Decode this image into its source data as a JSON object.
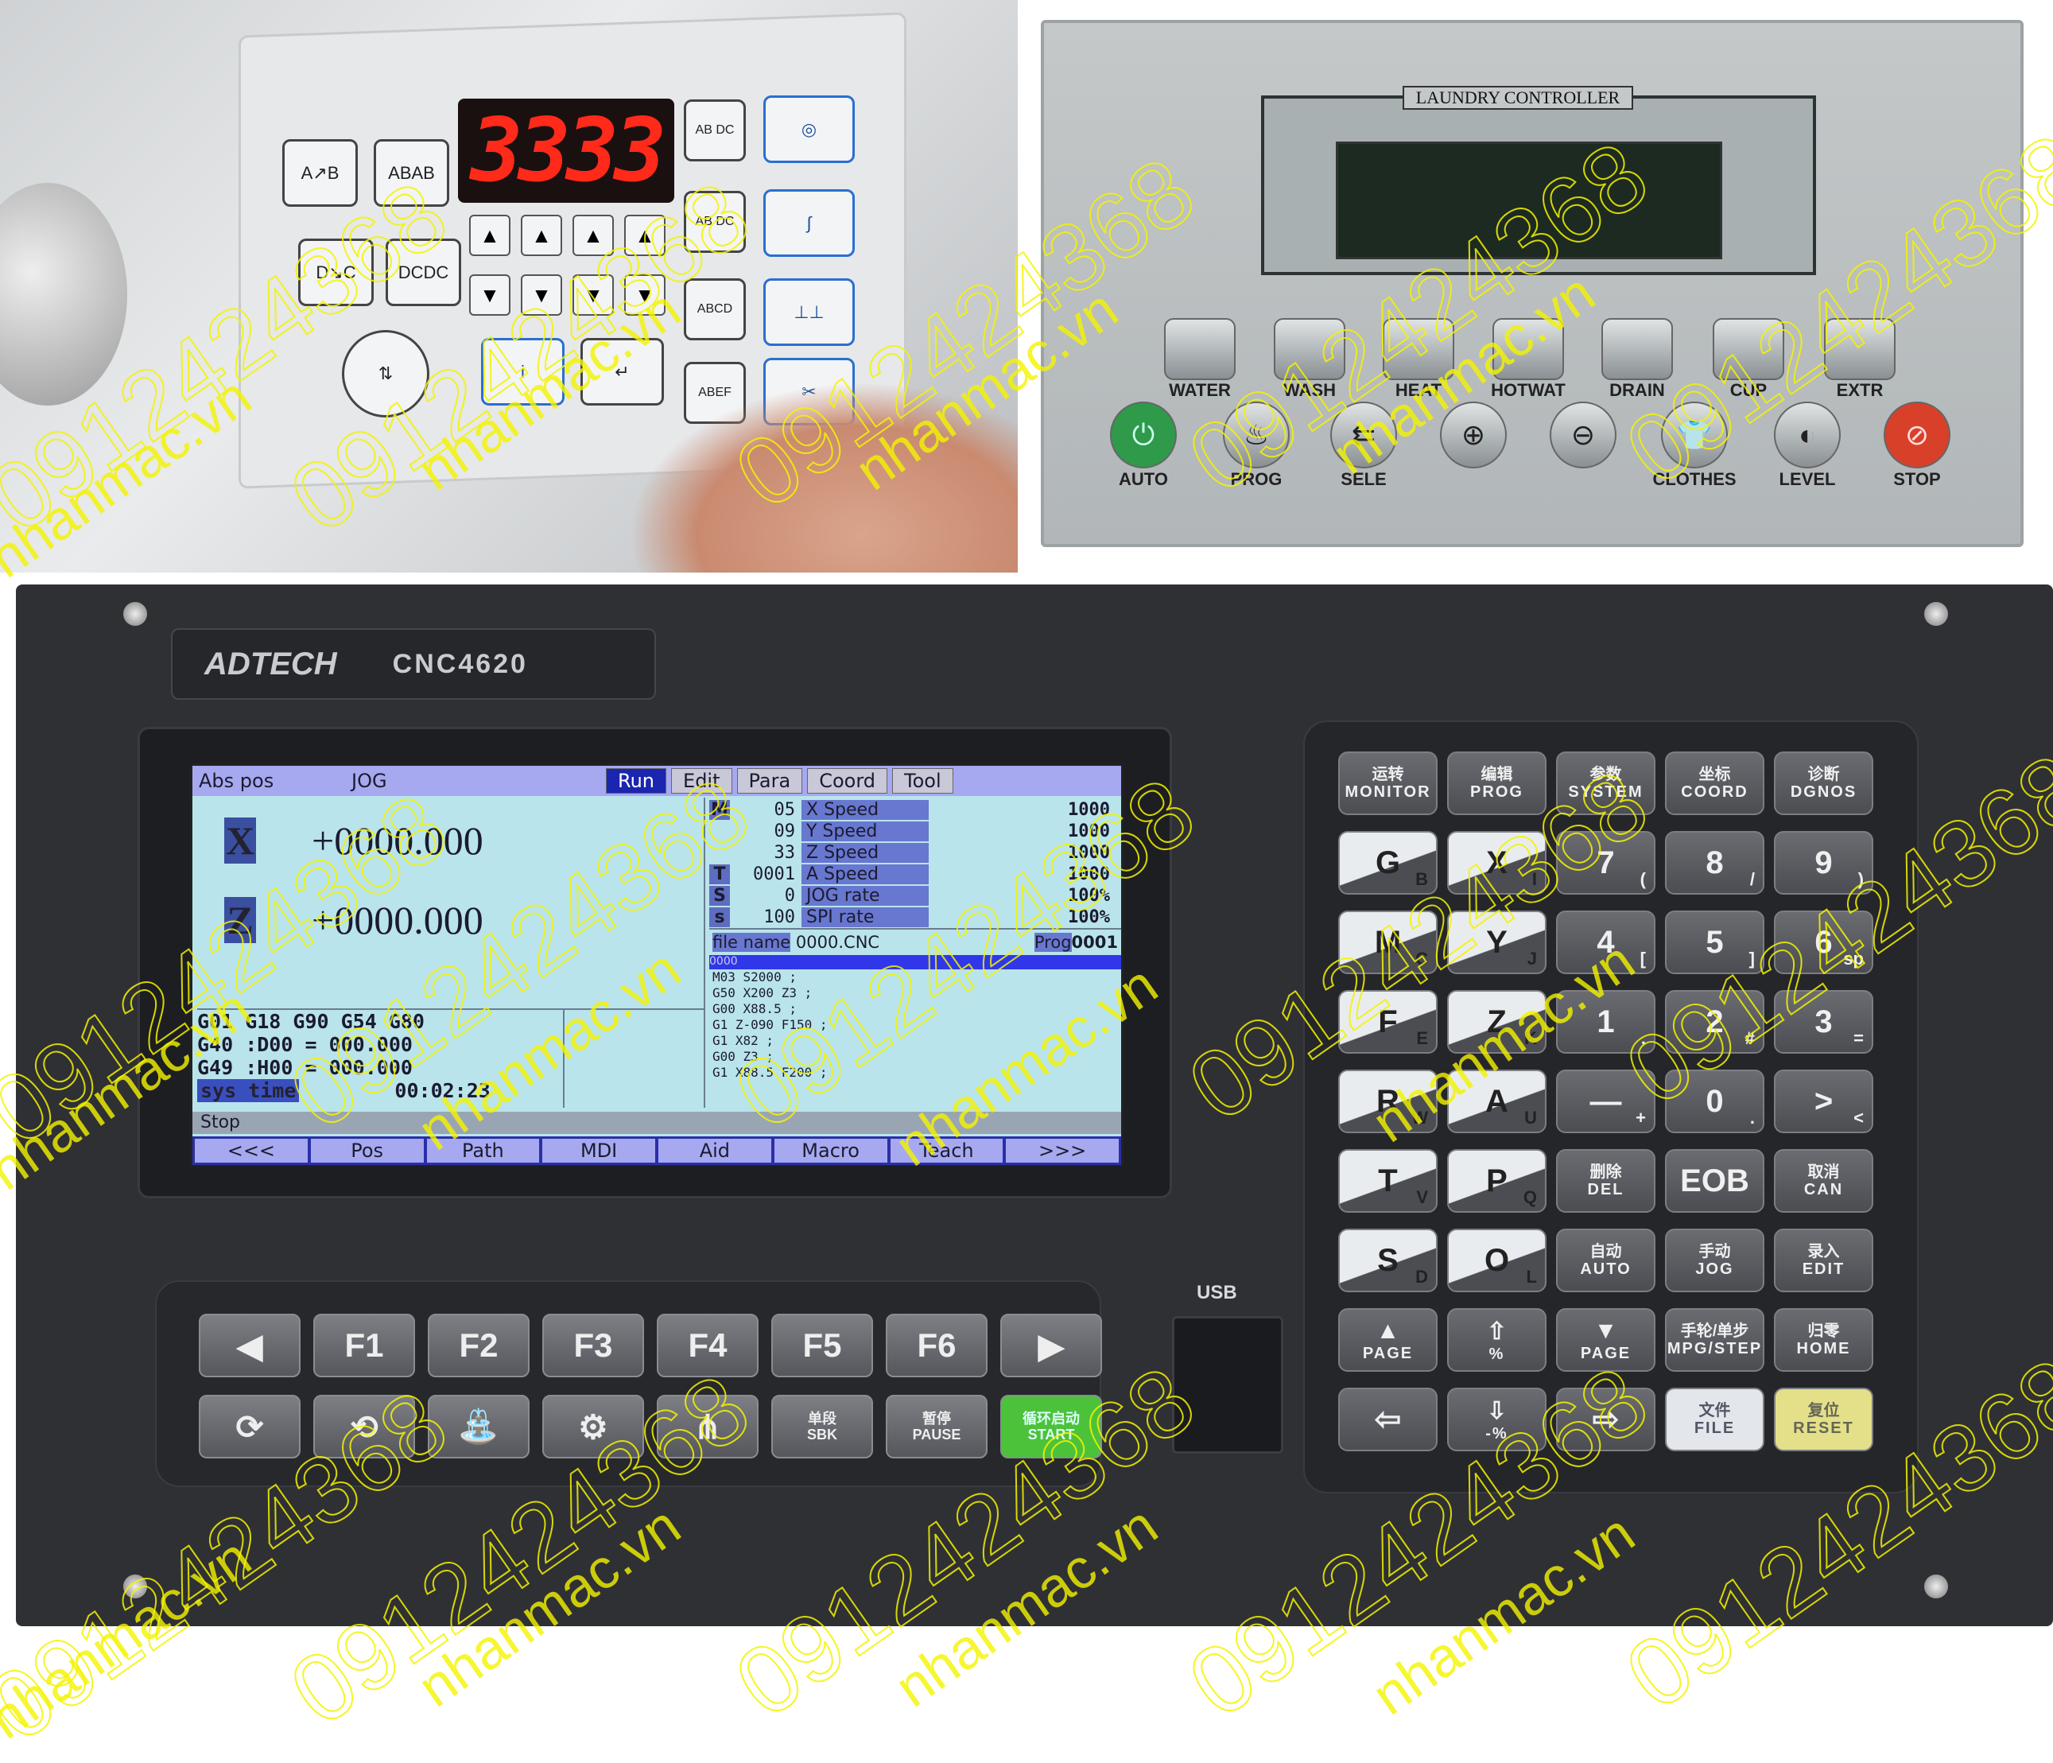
{
  "sewing_panel": {
    "display_value": "3333",
    "display_color": "#ff2a1a"
  },
  "laundry": {
    "title": "LAUNDRY CONTROLLER",
    "row1": [
      "WATER",
      "WASH",
      "HEAT",
      "HOTWAT",
      "DRAIN",
      "CUP",
      "EXTR"
    ],
    "row2": [
      "AUTO",
      "PROG",
      "SELE",
      "⊕",
      "⊖",
      "CLOTHES",
      "LEVEL",
      "STOP"
    ],
    "auto_color": "#2e9a4a",
    "stop_color": "#d8402a"
  },
  "cnc": {
    "brand": "ADTECH",
    "model": "CNC4620",
    "usb_label": "USB",
    "screen": {
      "tabs": [
        "Abs pos",
        "JOG",
        "Run",
        "Edit",
        "Para",
        "Coord",
        "Tool"
      ],
      "active_tab": "Run",
      "axes": [
        {
          "label": "X",
          "value": "+0000.000"
        },
        {
          "label": "Z",
          "value": "+0000.000"
        }
      ],
      "gcode_lines": [
        "G01  G18  G90  G54  G80",
        "G40  :D00  =  000.000",
        "G49  :H00  =  000.000"
      ],
      "sys_time_label": "sys time",
      "sys_time": "00:02:23",
      "stats": [
        {
          "k": "M",
          "v": "05",
          "name": "X Speed",
          "rate": "1000"
        },
        {
          "k": "",
          "v": "09",
          "name": "Y Speed",
          "rate": "1000"
        },
        {
          "k": "",
          "v": "33",
          "name": "Z Speed",
          "rate": "1000"
        },
        {
          "k": "T",
          "v": "0001",
          "name": "A Speed",
          "rate": "1000"
        },
        {
          "k": "S",
          "v": "0",
          "name": "JOG rate",
          "rate": "100%"
        },
        {
          "k": "s",
          "v": "100",
          "name": "SPI rate",
          "rate": "100%"
        }
      ],
      "file_label": "file name",
      "file_name": "0000.CNC",
      "prog_label": "Prog",
      "prog_no": "0001",
      "program_highlight": "0000",
      "program_lines": [
        "M03 S2000 ;",
        "G50 X200 Z3 ;",
        "G00 X88.5 ;",
        "G1 Z-090 F150 ;",
        "G1 X82 ;",
        "G00 Z3 ;",
        "G1 X88.5 F200 ;"
      ],
      "status": "Stop",
      "softkeys": [
        "<<<",
        "Pos",
        "Path",
        "MDI",
        "Aid",
        "Macro",
        "Teach",
        ">>>"
      ]
    },
    "function_keys": [
      {
        "label": "◀"
      },
      {
        "label": "F1"
      },
      {
        "label": "F2"
      },
      {
        "label": "F3"
      },
      {
        "label": "F4"
      },
      {
        "label": "F5"
      },
      {
        "label": "F6"
      },
      {
        "label": "▶"
      }
    ],
    "control_keys": [
      {
        "label": "⟳",
        "icon": "spindle-cw-icon"
      },
      {
        "label": "⟲",
        "icon": "spindle-ccw-icon"
      },
      {
        "label": "⛲",
        "icon": "coolant-icon"
      },
      {
        "label": "⚙",
        "icon": "spindle-stop-icon"
      },
      {
        "label": "⋔",
        "icon": "tool-change-icon"
      },
      {
        "cn": "单段",
        "en": "SBK"
      },
      {
        "cn": "暂停",
        "en": "PAUSE"
      },
      {
        "cn": "循环启动",
        "en": "START"
      }
    ],
    "start_color": "#4cc23a",
    "keypad": [
      [
        {
          "cn": "运转",
          "en": "MONITOR"
        },
        {
          "cn": "编辑",
          "en": "PROG"
        },
        {
          "cn": "参数",
          "en": "SYSTEM"
        },
        {
          "cn": "坐标",
          "en": "COORD"
        },
        {
          "cn": "诊断",
          "en": "DGNOS"
        }
      ],
      [
        {
          "main": "G",
          "sub": "B",
          "t": "w"
        },
        {
          "main": "X",
          "sub": "I",
          "t": "w"
        },
        {
          "main": "7",
          "sub": "("
        },
        {
          "main": "8",
          "sub": "/"
        },
        {
          "main": "9",
          "sub": ")"
        }
      ],
      [
        {
          "main": "M",
          "sub": "C",
          "t": "w"
        },
        {
          "main": "Y",
          "sub": "J",
          "t": "w"
        },
        {
          "main": "4",
          "sub": "["
        },
        {
          "main": "5",
          "sub": "]"
        },
        {
          "main": "6",
          "sub": "sp"
        }
      ],
      [
        {
          "main": "F",
          "sub": "E",
          "t": "w"
        },
        {
          "main": "Z",
          "sub": "K",
          "t": "w"
        },
        {
          "main": "1",
          "sub": "."
        },
        {
          "main": "2",
          "sub": "#"
        },
        {
          "main": "3",
          "sub": "="
        }
      ],
      [
        {
          "main": "R",
          "sub": "W",
          "t": "w"
        },
        {
          "main": "A",
          "sub": "U",
          "t": "w"
        },
        {
          "main": "—",
          "sub": "+"
        },
        {
          "main": "0",
          "sub": "."
        },
        {
          "main": ">",
          "sub": "<"
        }
      ],
      [
        {
          "main": "T",
          "sub": "V",
          "t": "w"
        },
        {
          "main": "P",
          "sub": "Q",
          "t": "w"
        },
        {
          "cn": "删除",
          "en": "DEL"
        },
        {
          "main": "EOB"
        },
        {
          "cn": "取消",
          "en": "CAN"
        }
      ],
      [
        {
          "main": "S",
          "sub": "D",
          "t": "w"
        },
        {
          "main": "O",
          "sub": "L",
          "t": "w"
        },
        {
          "cn": "自动",
          "en": "AUTO"
        },
        {
          "cn": "手动",
          "en": "JOG"
        },
        {
          "cn": "录入",
          "en": "EDIT"
        }
      ],
      [
        {
          "main": "▲",
          "en": "PAGE"
        },
        {
          "main": "⇧",
          "en": "%"
        },
        {
          "main": "▼",
          "en": "PAGE"
        },
        {
          "cn": "手轮/单步",
          "en": "MPG/STEP"
        },
        {
          "cn": "归零",
          "en": "HOME"
        }
      ],
      [
        {
          "main": "⇦"
        },
        {
          "main": "⇩",
          "en": "-%"
        },
        {
          "main": "⇨"
        },
        {
          "cn": "文件",
          "en": "FILE",
          "t": "f"
        },
        {
          "cn": "复位",
          "en": "RESET",
          "t": "y"
        }
      ]
    ]
  },
  "watermark": {
    "phone": "0912424368",
    "site": "nhanmac.vn",
    "color": "#f4f400"
  }
}
